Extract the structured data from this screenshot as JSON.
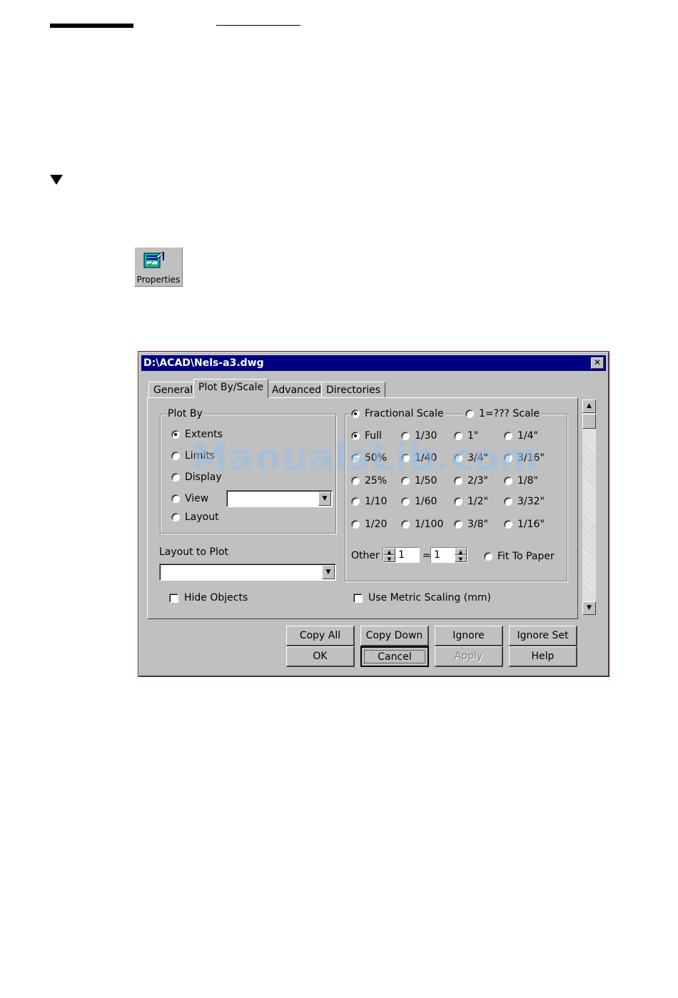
{
  "toolbar": {
    "properties_label": "Properties"
  },
  "dialog": {
    "title": "D:\\ACAD\\Nels-a3.dwg",
    "close_glyph": "✕",
    "tabs": [
      "General",
      "Plot By/Scale",
      "Advanced",
      "Directories"
    ],
    "active_tab": "Plot By/Scale",
    "plot_by": {
      "legend": "Plot By",
      "options": [
        "Extents",
        "Limits",
        "Display",
        "View",
        "Layout"
      ],
      "selected": "Extents",
      "view_value": ""
    },
    "layout_to_plot": {
      "label": "Layout to Plot",
      "value": ""
    },
    "hide_objects": {
      "label": "Hide Objects",
      "checked": false
    },
    "scale": {
      "fractional_label": "Fractional Scale",
      "one_eq_label": "1=??? Scale",
      "mode": "Fractional Scale",
      "rows": [
        [
          "Full",
          "1/30",
          "1\"",
          "1/4\""
        ],
        [
          "50%",
          "1/40",
          "3/4\"",
          "3/16\""
        ],
        [
          "25%",
          "1/50",
          "2/3\"",
          "1/8\""
        ],
        [
          "1/10",
          "1/60",
          "1/2\"",
          "3/32\""
        ],
        [
          "1/20",
          "1/100",
          "3/8\"",
          "1/16\""
        ]
      ],
      "selected": "Full",
      "other_label": "Other",
      "other_left": "1",
      "equals": "=",
      "other_right": "1",
      "fit_to_paper": "Fit To Paper"
    },
    "metric": {
      "label": "Use Metric Scaling (mm)",
      "checked": false
    },
    "buttons": {
      "copy_all": "Copy All",
      "copy_down": "Copy Down",
      "ignore": "Ignore",
      "ignore_set": "Ignore Set",
      "ok": "OK",
      "cancel": "Cancel",
      "apply": "Apply",
      "help": "Help"
    }
  },
  "watermark": "ManualsLib.com",
  "colors": {
    "titlebar": "#000080",
    "face": "#c0c0c0",
    "watermark": "#96bee6"
  }
}
